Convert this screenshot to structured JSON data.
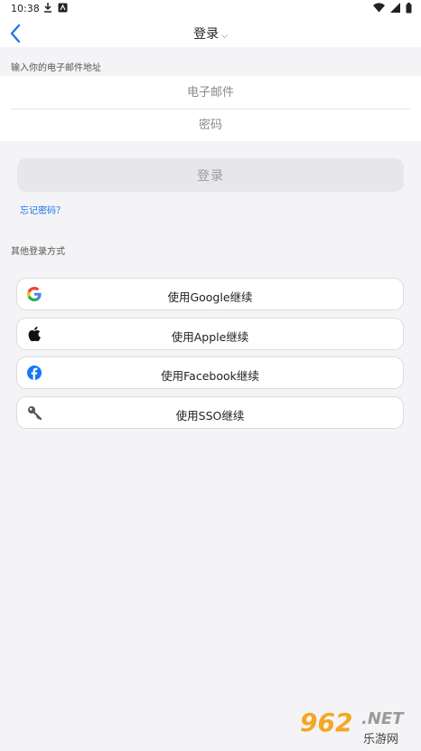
{
  "status_bar": {
    "time": "10:38",
    "icons": [
      "download-icon",
      "notification-icon",
      "wifi-icon",
      "signal-icon",
      "battery-icon"
    ]
  },
  "nav": {
    "title": "登录",
    "back_icon": "chevron-left-icon",
    "title_icon": "chevron-down-icon"
  },
  "form": {
    "email_section_label": "输入你的电子邮件地址",
    "email_placeholder": "电子邮件",
    "password_placeholder": "密码",
    "login_label": "登录",
    "forgot_label": "忘记密码？"
  },
  "other": {
    "section_label": "其他登录方式",
    "providers": [
      {
        "label": "使用Google继续",
        "icon": "google-icon"
      },
      {
        "label": "使用Apple继续",
        "icon": "apple-icon"
      },
      {
        "label": "使用Facebook继续",
        "icon": "facebook-icon"
      },
      {
        "label": "使用SSO继续",
        "icon": "key-icon"
      }
    ]
  },
  "watermark": {
    "number": "962",
    "suffix": ".NET",
    "chinese": "乐游网"
  },
  "colors": {
    "accent": "#1a73e8",
    "background": "#f4f4f6",
    "disabled_button": "#e7e7ea",
    "facebook": "#1877f2",
    "watermark_orange": "#f5a623"
  }
}
